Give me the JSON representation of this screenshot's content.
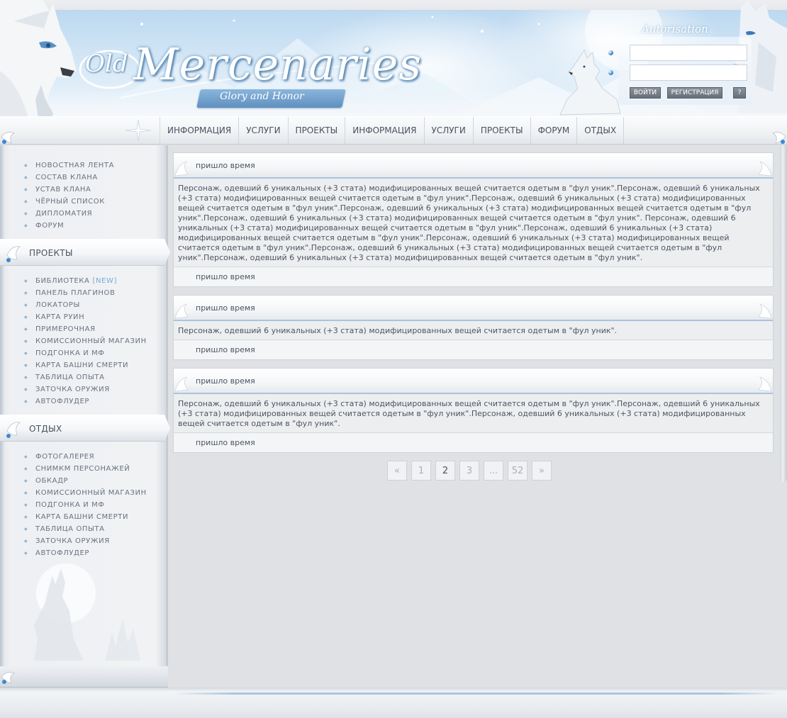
{
  "header": {
    "logo": {
      "prefix": "Old",
      "title": "Mercenaries",
      "tagline": "Glory and Honor"
    },
    "auth": {
      "title": "Autorisation",
      "login_button": "ВОЙТИ",
      "register_button": "РЕГИСТРАЦИЯ",
      "help_button": "?"
    },
    "nav": [
      "ИНФОРМАЦИЯ",
      "УСЛУГИ",
      "ПРОЕКТЫ",
      "ИНФОРМАЦИЯ",
      "УСЛУГИ",
      "ПРОЕКТЫ",
      "ФОРУМ",
      "ОТДЫХ"
    ]
  },
  "sidebar": {
    "main_menu": [
      "НОВОСТНАЯ ЛЕНТА",
      "СОСТАВ КЛАНА",
      "УСТАВ КЛАНА",
      "ЧЁРНЫЙ СПИСОК",
      "ДИПЛОМАТИЯ",
      "ФОРУМ"
    ],
    "projects": {
      "title": "ПРОЕКТЫ",
      "items": [
        "БИБЛИОТЕКА",
        "ПАНЕЛЬ ПЛАГИНОВ",
        "ЛОКАТОРЫ",
        "КАРТА РУИН",
        "ПРИМЕРОЧНАЯ",
        "КОМИССИОННЫЙ МАГАЗИН",
        "ПОДГОНКА И МФ",
        "КАРТА БАШНИ СМЕРТИ",
        "ТАБЛИЦА ОПЫТА",
        "ЗАТОЧКА ОРУЖИЯ",
        "АВТОФЛУДЕР"
      ],
      "new_badge": "[NEW]"
    },
    "rest": {
      "title": "ОТДЫХ",
      "items": [
        "ФОТОГАЛЕРЕЯ",
        "СНИМКМ ПЕРСОНАЖЕЙ",
        "ОБКАДР",
        "КОМИССИОННЫЙ МАГАЗИН",
        "ПОДГОНКА И МФ",
        "КАРТА БАШНИ СМЕРТИ",
        "ТАБЛИЦА ОПЫТА",
        "ЗАТОЧКА ОРУЖИЯ",
        "АВТОФЛУДЕР"
      ]
    }
  },
  "posts": [
    {
      "title": "пришло время",
      "body": "Персонаж, одевший 6 уникальных (+3 стата) модифицированных вещей считается одетым в \"фул уник\".Персонаж, одевший 6 уникальных (+3 стата) модифицированных вещей считается одетым в \"фул уник\".Персонаж, одевший 6 уникальных (+3 стата) модифицированных вещей считается одетым в \"фул уник\".Персонаж, одевший 6 уникальных (+3 стата) модифицированных вещей считается одетым в \"фул уник\".Персонаж, одевший 6 уникальных (+3 стата) модифицированных вещей считается одетым в \"фул уник\". Персонаж, одевший 6 уникальных (+3 стата) модифицированных вещей считается одетым в \"фул уник\".Персонаж, одевший 6 уникальных (+3 стата) модифицированных вещей считается одетым в \"фул уник\".Персонаж, одевший 6 уникальных (+3 стата) модифицированных вещей считается одетым в \"фул уник\".Персонаж, одевший 6 уникальных (+3 стата) модифицированных вещей считается одетым в \"фул уник\".Персонаж, одевший 6 уникальных (+3 стата) модифицированных вещей считается одетым в \"фул уник\".",
      "footer": "пришло время"
    },
    {
      "title": "пришло время",
      "body": "Персонаж, одевший 6 уникальных (+3 стата) модифицированных вещей считается одетым в \"фул уник\".",
      "footer": "пришло время"
    },
    {
      "title": "пришло время",
      "body": "Персонаж, одевший 6 уникальных (+3 стата) модифицированных вещей считается одетым в \"фул уник\".Персонаж, одевший 6 уникальных (+3 стата) модифицированных вещей считается одетым в \"фул уник\".Персонаж, одевший 6 уникальных (+3 стата) модифицированных вещей считается одетым в \"фул уник\".",
      "footer": "пришло время"
    }
  ],
  "pagination": {
    "prev": "«",
    "pages": [
      "1",
      "2",
      "3",
      "...",
      "52"
    ],
    "current": "2",
    "next": "»"
  },
  "colors": {
    "accent": "#a9c4de",
    "page_bg": "#dfe1e4",
    "text": "#4b5058",
    "new_badge": "#7aaad8"
  }
}
